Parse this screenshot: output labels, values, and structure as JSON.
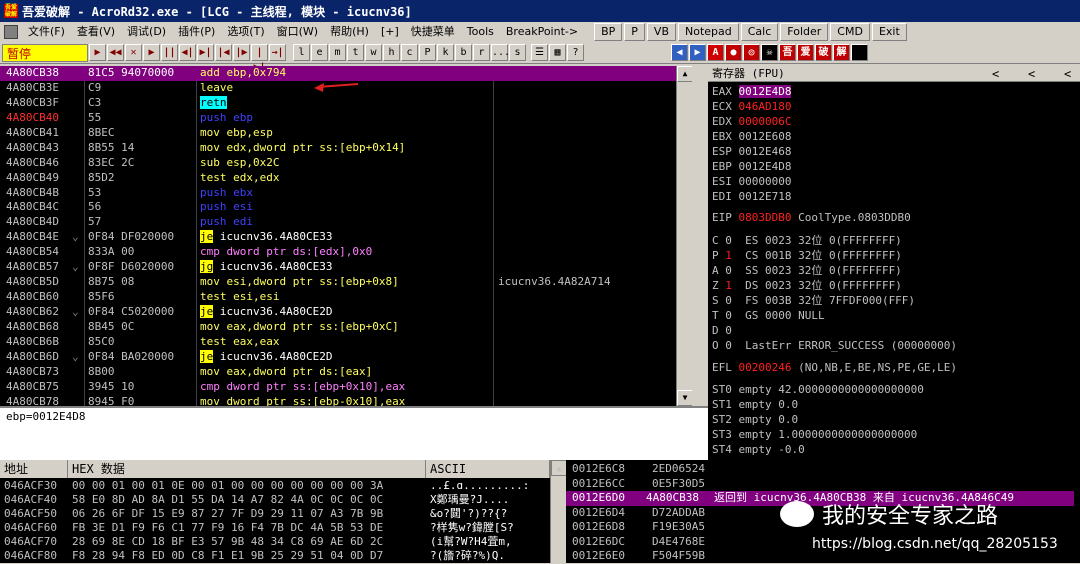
{
  "title": {
    "text": "吾爱破解 - AcroRd32.exe - [LCG - 主线程, 模块 - icucnv36]",
    "icon": "吾爱破解"
  },
  "menu": [
    "文件(F)",
    "查看(V)",
    "调试(D)",
    "插件(P)",
    "选项(T)",
    "窗口(W)",
    "帮助(H)",
    "[+]",
    "快捷菜单",
    "Tools",
    "BreakPoint->"
  ],
  "plugin_buttons": [
    "BP",
    "P",
    "VB",
    "Notepad",
    "Calc",
    "Folder",
    "CMD",
    "Exit"
  ],
  "toolbar": {
    "status": "暂停",
    "buttons": [
      "▶",
      "◀◀",
      "✕",
      "▶",
      "||",
      "◀|",
      "▶|",
      "|◀",
      "|▶",
      "|▶|",
      "→|"
    ],
    "letters": [
      "l",
      "e",
      "m",
      "t",
      "w",
      "h",
      "c",
      "P",
      "k",
      "b",
      "r",
      "...",
      "s"
    ],
    "right": [
      "☰",
      "▦",
      "?"
    ],
    "colored": [
      "◀",
      "▶",
      "A",
      "●",
      "◎",
      "☠",
      "吾",
      "爱",
      "破",
      "解",
      ""
    ]
  },
  "cpu": [
    {
      "addr": "4A80CB38",
      "mark": "",
      "hex": "81C5 94070000",
      "op": "add",
      "args": "ebp,0x794",
      "cmt": "",
      "sel": true,
      "opcls": "arith"
    },
    {
      "addr": "4A80CB3E",
      "mark": "",
      "hex": "C9",
      "op": "leave",
      "args": "",
      "cmt": "",
      "opcls": "plain"
    },
    {
      "addr": "4A80CB3F",
      "mark": "",
      "hex": "C3",
      "op": "retn",
      "args": "",
      "cmt": "",
      "opcls": "retn"
    },
    {
      "addr": "4A80CB40",
      "mark": "",
      "hex": "55",
      "op": "push",
      "args": "ebp",
      "cmt": "",
      "opcls": "push",
      "addrRed": true
    },
    {
      "addr": "4A80CB41",
      "mark": "",
      "hex": "8BEC",
      "op": "mov",
      "args": "ebp,esp",
      "cmt": "",
      "opcls": "plain"
    },
    {
      "addr": "4A80CB43",
      "mark": "",
      "hex": "8B55 14",
      "op": "mov",
      "args": "edx,dword ptr ss:[ebp+0x14]",
      "cmt": "",
      "opcls": "plain"
    },
    {
      "addr": "4A80CB46",
      "mark": "",
      "hex": "83EC 2C",
      "op": "sub",
      "args": "esp,0x2C",
      "cmt": "",
      "opcls": "arith"
    },
    {
      "addr": "4A80CB49",
      "mark": "",
      "hex": "85D2",
      "op": "test",
      "args": "edx,edx",
      "cmt": "",
      "opcls": "plain"
    },
    {
      "addr": "4A80CB4B",
      "mark": "",
      "hex": "53",
      "op": "push",
      "args": "ebx",
      "cmt": "",
      "opcls": "push"
    },
    {
      "addr": "4A80CB4C",
      "mark": "",
      "hex": "56",
      "op": "push",
      "args": "esi",
      "cmt": "",
      "opcls": "push"
    },
    {
      "addr": "4A80CB4D",
      "mark": "",
      "hex": "57",
      "op": "push",
      "args": "edi",
      "cmt": "",
      "opcls": "push"
    },
    {
      "addr": "4A80CB4E",
      "mark": "⌄",
      "hex": "0F84 DF020000",
      "op": "je",
      "args": "icucnv36.4A80CE33",
      "cmt": "",
      "opcls": "jmp"
    },
    {
      "addr": "4A80CB54",
      "mark": "",
      "hex": "833A 00",
      "op": "cmp",
      "args": "dword ptr ds:[edx],0x0",
      "cmt": "",
      "opcls": "cmp"
    },
    {
      "addr": "4A80CB57",
      "mark": "⌄",
      "hex": "0F8F D6020000",
      "op": "jg",
      "args": "icucnv36.4A80CE33",
      "cmt": "",
      "opcls": "jmp"
    },
    {
      "addr": "4A80CB5D",
      "mark": "",
      "hex": "8B75 08",
      "op": "mov",
      "args": "esi,dword ptr ss:[ebp+0x8]",
      "cmt": "icucnv36.4A82A714",
      "opcls": "plain"
    },
    {
      "addr": "4A80CB60",
      "mark": "",
      "hex": "85F6",
      "op": "test",
      "args": "esi,esi",
      "cmt": "",
      "opcls": "plain"
    },
    {
      "addr": "4A80CB62",
      "mark": "⌄",
      "hex": "0F84 C5020000",
      "op": "je",
      "args": "icucnv36.4A80CE2D",
      "cmt": "",
      "opcls": "jmp"
    },
    {
      "addr": "4A80CB68",
      "mark": "",
      "hex": "8B45 0C",
      "op": "mov",
      "args": "eax,dword ptr ss:[ebp+0xC]",
      "cmt": "",
      "opcls": "plain"
    },
    {
      "addr": "4A80CB6B",
      "mark": "",
      "hex": "85C0",
      "op": "test",
      "args": "eax,eax",
      "cmt": "",
      "opcls": "plain"
    },
    {
      "addr": "4A80CB6D",
      "mark": "⌄",
      "hex": "0F84 BA020000",
      "op": "je",
      "args": "icucnv36.4A80CE2D",
      "cmt": "",
      "opcls": "jmp"
    },
    {
      "addr": "4A80CB73",
      "mark": "",
      "hex": "8B00",
      "op": "mov",
      "args": "eax,dword ptr ds:[eax]",
      "cmt": "",
      "opcls": "plain"
    },
    {
      "addr": "4A80CB75",
      "mark": "",
      "hex": "3945 10",
      "op": "cmp",
      "args": "dword ptr ss:[ebp+0x10],eax",
      "cmt": "",
      "opcls": "cmp"
    },
    {
      "addr": "4A80CB78",
      "mark": "",
      "hex": "8945 F0",
      "op": "mov",
      "args": "dword ptr ss:[ebp-0x10],eax",
      "cmt": "",
      "opcls": "plain"
    }
  ],
  "info": "ebp=0012E4D8",
  "regs": {
    "header": "寄存器 (FPU)",
    "nav": [
      "<",
      "<",
      "<"
    ],
    "lines": [
      {
        "t": "EAX ",
        "v": "0012E4D8",
        "vc": "hl"
      },
      {
        "t": "ECX ",
        "v": "046AD180",
        "vc": "red"
      },
      {
        "t": "EDX ",
        "v": "0000006C",
        "vc": "red"
      },
      {
        "t": "EBX 0012E608",
        "v": "",
        "vc": ""
      },
      {
        "t": "ESP 0012E468",
        "v": "",
        "vc": ""
      },
      {
        "t": "EBP 0012E4D8",
        "v": "",
        "vc": ""
      },
      {
        "t": "ESI 00000000",
        "v": "",
        "vc": ""
      },
      {
        "t": "EDI 0012E718",
        "v": "",
        "vc": ""
      },
      {
        "t": "EIP ",
        "v": "0803DDB0",
        "vc": "red",
        "rest": " CoolType.0803DDB0"
      },
      {
        "t": "C 0  ES 0023 32位 0(FFFFFFFF)",
        "v": "",
        "vc": ""
      },
      {
        "t": "P ",
        "v": "1",
        "vc": "red",
        "rest": "  CS 001B 32位 0(FFFFFFFF)"
      },
      {
        "t": "A 0  SS 0023 32位 0(FFFFFFFF)",
        "v": "",
        "vc": ""
      },
      {
        "t": "Z ",
        "v": "1",
        "vc": "red",
        "rest": "  DS 0023 32位 0(FFFFFFFF)"
      },
      {
        "t": "S 0  FS 003B 32位 7FFDF000(FFF)",
        "v": "",
        "vc": ""
      },
      {
        "t": "T 0  GS 0000 NULL",
        "v": "",
        "vc": ""
      },
      {
        "t": "D 0",
        "v": "",
        "vc": ""
      },
      {
        "t": "O 0  LastErr ERROR_SUCCESS (00000000)",
        "v": "",
        "vc": ""
      },
      {
        "t": "EFL ",
        "v": "00200246",
        "vc": "red",
        "rest": " (NO,NB,E,BE,NS,PE,GE,LE)"
      },
      {
        "t": "ST0 empty 42.0000000000000000000",
        "v": "",
        "vc": ""
      },
      {
        "t": "ST1 empty 0.0",
        "v": "",
        "vc": ""
      },
      {
        "t": "ST2 empty 0.0",
        "v": "",
        "vc": ""
      },
      {
        "t": "ST3 empty 1.0000000000000000000",
        "v": "",
        "vc": ""
      },
      {
        "t": "ST4 empty -0.0",
        "v": "",
        "vc": ""
      }
    ]
  },
  "dump": {
    "headers": [
      "地址",
      "HEX 数据",
      "ASCII"
    ],
    "rows": [
      {
        "a": "046ACF30",
        "h": "00 00 01 00 01 0E 00 01 00 00 00 00 00 00 00 3A",
        "s": "..£.ɑ.........:"
      },
      {
        "a": "046ACF40",
        "h": "58 E0 8D AD 8A D1 55 DA 14 A7 82 4A 0C 0C 0C 0C",
        "s": "X鄭瑀曼?J...."
      },
      {
        "a": "046ACF50",
        "h": "06 26 6F DF 15 E9 87 27 7F D9 29 11 07 A3 7B 9B",
        "s": "&o?閮'?)??{?"
      },
      {
        "a": "046ACF60",
        "h": "FB 3E D1 F9 F6 C1 77 F9 16 F4 7B DC 4A 5B 53 DE",
        "s": "?样隽w?鍏膛[S?"
      },
      {
        "a": "046ACF70",
        "h": "28 69 8E CD 18 BF E3 57 9B 48 34 C8 69 AE 6D 2C",
        "s": "(i幫?W?H4萓m,"
      },
      {
        "a": "046ACF80",
        "h": "F8 28 94 F8 ED 0D C8 F1 E1 9B 25 29 51 04 0D D7",
        "s": "?(旝?碎?%)Q."
      }
    ]
  },
  "stack": [
    {
      "a": "0012E6C8",
      "v": "2ED06524",
      "c": ""
    },
    {
      "a": "0012E6CC",
      "v": "0E5F30D5",
      "c": ""
    },
    {
      "a": "0012E6D0",
      "v": "4A80CB38",
      "c": "返回到 icucnv36.4A80CB38 来自 icucnv36.4A846C49",
      "sel": true
    },
    {
      "a": "0012E6D4",
      "v": "D72ADDAB",
      "c": ""
    },
    {
      "a": "0012E6D8",
      "v": "F19E30A5",
      "c": ""
    },
    {
      "a": "0012E6DC",
      "v": "D4E4768E",
      "c": ""
    },
    {
      "a": "0012E6E0",
      "v": "F504F59B",
      "c": ""
    }
  ],
  "watermark": {
    "text": "我的安全专家之路",
    "url": "https://blog.csdn.net/qq_28205153"
  },
  "colors": {
    "arrow": "#e02020",
    "selection": "#800080"
  }
}
